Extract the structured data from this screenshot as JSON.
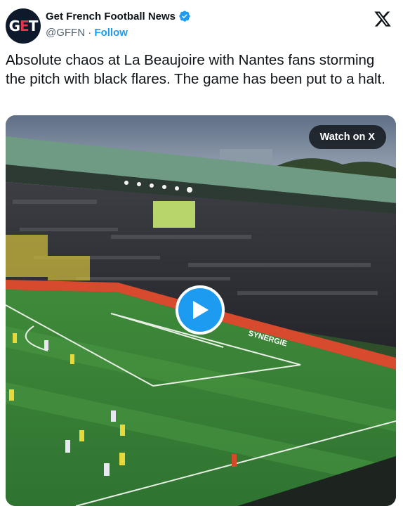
{
  "author": {
    "avatar_text_a": "G",
    "avatar_text_b": "E",
    "avatar_text_c": "T",
    "name": "Get French Football News",
    "handle": "@GFFN",
    "separator": "·",
    "follow_label": "Follow"
  },
  "tweet": {
    "text": "Absolute chaos at La Beaujoire with Nantes fans storming the pitch with black flares. The game has been put to a halt."
  },
  "media": {
    "watch_label": "Watch on X",
    "board_text": "SYNERGIE"
  },
  "colors": {
    "accent": "#1d9bf0",
    "avatar_bg": "#0e1a2b",
    "avatar_accent": "#e8334a"
  },
  "icons": {
    "verified": "verified-badge-icon",
    "brand": "x-logo-icon",
    "play": "play-icon"
  }
}
